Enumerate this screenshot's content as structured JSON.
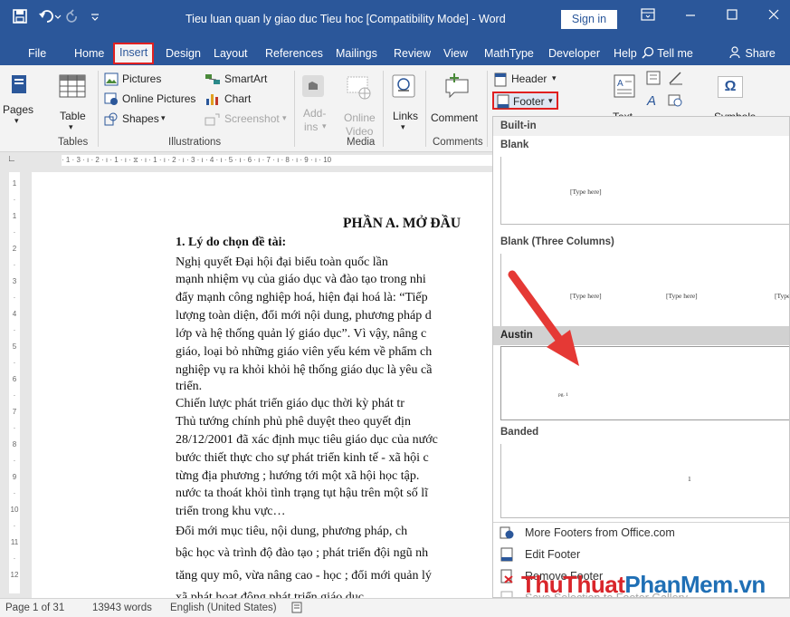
{
  "titlebar": {
    "title": "Tieu luan quan ly giao duc Tieu hoc [Compatibility Mode] - Word",
    "sign_in": "Sign in",
    "icons": [
      "save-icon",
      "undo-icon",
      "redo-icon",
      "customize-icon",
      "ribbon-display-icon",
      "minimize-icon",
      "maximize-icon",
      "close-icon"
    ]
  },
  "tabs": [
    "File",
    "Home",
    "Insert",
    "Design",
    "Layout",
    "References",
    "Mailings",
    "Review",
    "View",
    "MathType",
    "Developer",
    "Help",
    "Tell me",
    "Share"
  ],
  "active_tab": "Insert",
  "ribbon": {
    "pages": "Pages",
    "table": "Table",
    "tables_group": "Tables",
    "pictures": "Pictures",
    "online_pictures": "Online Pictures",
    "shapes": "Shapes",
    "smartart": "SmartArt",
    "chart": "Chart",
    "screenshot": "Screenshot",
    "illustrations_group": "Illustrations",
    "addins_1": "Add-",
    "addins_2": "ins",
    "online_video_1": "Online",
    "online_video_2": "Video",
    "media_group": "Media",
    "links": "Links",
    "comment": "Comment",
    "comments_group": "Comments",
    "header": "Header",
    "footer": "Footer",
    "text_group_partial": "Text",
    "symbols_partial": "Symbols",
    "omega": "Ω"
  },
  "ruler": {
    "horizontal": "· 1 · 3 · ı · 2 · ı · 1 · ı · ⧖ · ı · 1 · ı · 2 · ı · 3 · ı · 4 · ı · 5 · ı · 6 · ı · 7 · ı · 8 · ı · 9 · ı · 10",
    "vertical": [
      "1",
      "·",
      "1",
      "·",
      "2",
      "·",
      "3",
      "·",
      "4",
      "·",
      "5",
      "·",
      "6",
      "·",
      "7",
      "·",
      "8",
      "·",
      "9",
      "·",
      "10",
      "·",
      "11",
      "·",
      "12"
    ]
  },
  "document": {
    "heading": "PHẦN A.  MỞ ĐẦU",
    "lines": [
      "1. Lý do chọn đề tài:",
      "           Nghị quyết Đại hội đại biểu toàn quốc lần",
      "mạnh nhiệm vụ của giáo dục và đào tạo  trong nhi",
      "đẩy mạnh công nghiệp hoá, hiện đại hoá là: “Tiếp",
      "lượng toàn diện, đổi mới nội dung, phương pháp d",
      "lớp và hệ thống quản lý giáo dục”. Vì vậy, nâng c",
      "giáo, loại bỏ những giáo viên yếu kém về phẩm ch",
      "nghiệp vụ ra khỏi khỏi hệ thống giáo dục là yêu cầ",
      "triển.",
      "         Chiến lược phát triển giáo dục thời kỳ phát tr",
      "Thủ tướng chính phủ phê duyệt theo quyết địn",
      "28/12/2001 đã xác định mục tiêu giáo dục của nước",
      "bước thiết thực cho sự phát triển kinh tế - xã hội c",
      "từng địa phương ; hướng tới một xã hội học tập. ",
      "nước ta thoát khỏi tình trạng tụt hậu trên một số lĩ",
      "triển trong khu vực…",
      "     Đổi mới mục tiêu, nội dung, phương pháp, ch",
      "bậc học và trình độ đào tạo ; phát triển đội ngũ nh",
      "tăng quy mô, vừa nâng cao - học ; đổi mới quản lý",
      "xã phát hoạt động phát triển giáo dục"
    ]
  },
  "gallery": {
    "built_in": "Built-in",
    "sections": [
      "Blank",
      "Blank (Three Columns)",
      "Austin",
      "Banded"
    ],
    "selected": "Austin",
    "placeholder": "[Type here]",
    "austin_page": "pg. 1",
    "banded_page": "1",
    "menu": [
      "More Footers from Office.com",
      "Edit Footer",
      "Remove Footer",
      "Save Selection to Footer Gallery..."
    ],
    "watermark_1": "ThuThuat",
    "watermark_2": "PhanMem",
    "watermark_3": ".vn"
  },
  "statusbar": {
    "page": "Page 1 of 31",
    "words": "13943 words",
    "language": "English (United States)"
  },
  "colors": {
    "word_blue": "#2b579a",
    "highlight_red": "#e02020",
    "arrow_red": "#e53935",
    "watermark_red": "#d9252a",
    "watermark_blue": "#1f6fb5"
  }
}
